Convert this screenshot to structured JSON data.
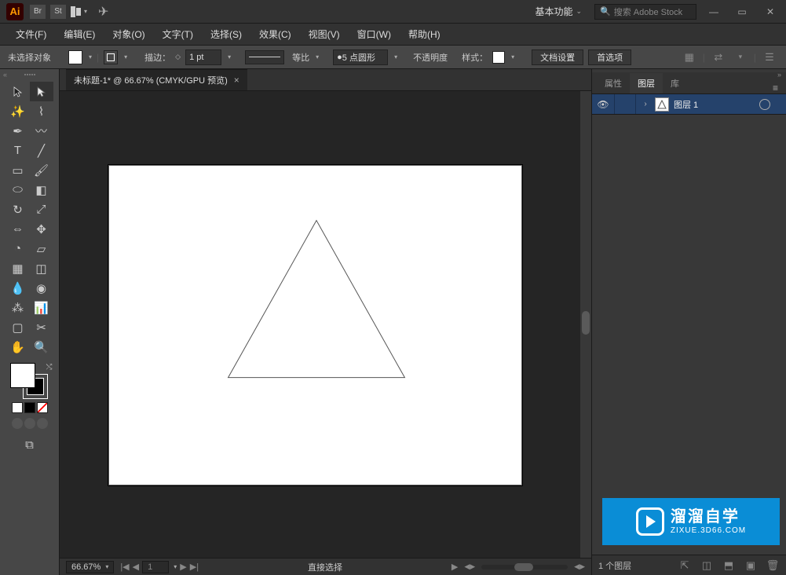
{
  "title_bar": {
    "workspace": "基本功能",
    "search_placeholder": "搜索 Adobe Stock"
  },
  "menu": {
    "file": "文件(F)",
    "edit": "编辑(E)",
    "object": "对象(O)",
    "type": "文字(T)",
    "select": "选择(S)",
    "effect": "效果(C)",
    "view": "视图(V)",
    "window": "窗口(W)",
    "help": "帮助(H)"
  },
  "control": {
    "no_selection": "未选择对象",
    "stroke_label": "描边：",
    "stroke_weight": "1 pt",
    "uniform": "等比",
    "brush": "5 点圆形",
    "opacity_label": "不透明度",
    "style_label": "样式：",
    "doc_setup": "文档设置",
    "prefs": "首选项"
  },
  "document": {
    "tab_title": "未标题-1* @ 66.67% (CMYK/GPU 预览)"
  },
  "status": {
    "zoom": "66.67%",
    "page": "1",
    "tool": "直接选择"
  },
  "panels": {
    "props": "属性",
    "layers": "图层",
    "libs": "库",
    "layer1": "图层 1",
    "footer_count": "1 个图层"
  },
  "watermark": {
    "cn": "溜溜自学",
    "en": "ZIXUE.3D66.COM"
  }
}
